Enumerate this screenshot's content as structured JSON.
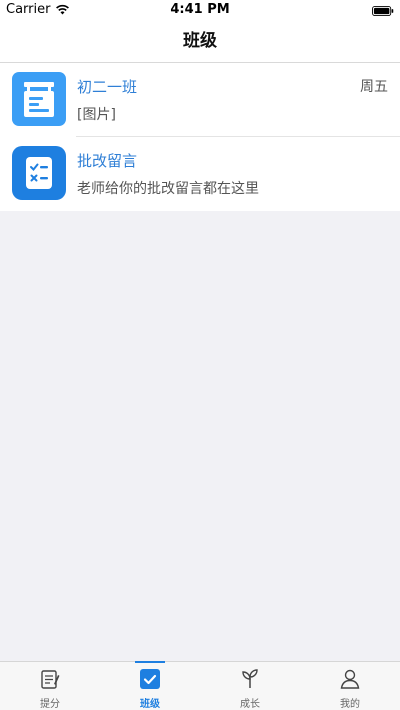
{
  "status_bar": {
    "carrier": "Carrier",
    "time": "4:41 PM"
  },
  "nav": {
    "title": "班级"
  },
  "conversations": [
    {
      "title": "初二一班",
      "subtitle": "[图片]",
      "time": "周五",
      "icon": "class-board-icon",
      "icon_color": "#3b9ef5"
    },
    {
      "title": "批改留言",
      "subtitle": "老师给你的批改留言都在这里",
      "time": "",
      "icon": "checklist-icon",
      "icon_color": "#1e7fe0"
    }
  ],
  "tabs": [
    {
      "label": "提分",
      "icon": "scroll-icon",
      "active": false
    },
    {
      "label": "班级",
      "icon": "class-check-icon",
      "active": true
    },
    {
      "label": "成长",
      "icon": "sprout-icon",
      "active": false
    },
    {
      "label": "我的",
      "icon": "person-icon",
      "active": false
    }
  ],
  "colors": {
    "accent": "#1e7fe0",
    "title_blue": "#2f7fd6",
    "background": "#f1f1f5"
  }
}
